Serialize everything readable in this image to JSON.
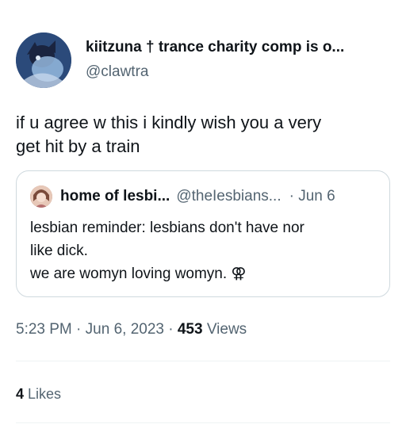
{
  "author": {
    "display_name": "kiitzuna † trance charity comp is o...",
    "handle": "@clawtra",
    "avatar_icon": "profile-avatar-icon"
  },
  "tweet": {
    "text_lines": [
      "if u agree w this i kindly wish you a very",
      "get hit by a train"
    ]
  },
  "quote": {
    "display_name": "home of lesbi...",
    "handle": "@theIesbians...",
    "date": "· Jun 6",
    "avatar_icon": "quoted-profile-avatar-icon",
    "text_lines": [
      "lesbian reminder: lesbians don't have nor",
      "like dick.",
      "we are womyn loving womyn. ⚢"
    ]
  },
  "meta": {
    "time": "5:23 PM",
    "separator": "·",
    "date": "Jun 6, 2023",
    "views_count": "453",
    "views_label": "Views"
  },
  "stats": {
    "likes_count": "4",
    "likes_label": "Likes"
  },
  "colors": {
    "text_primary": "#0f1419",
    "text_secondary": "#536471",
    "border": "#cfd9de",
    "divider": "#eff3f4"
  }
}
